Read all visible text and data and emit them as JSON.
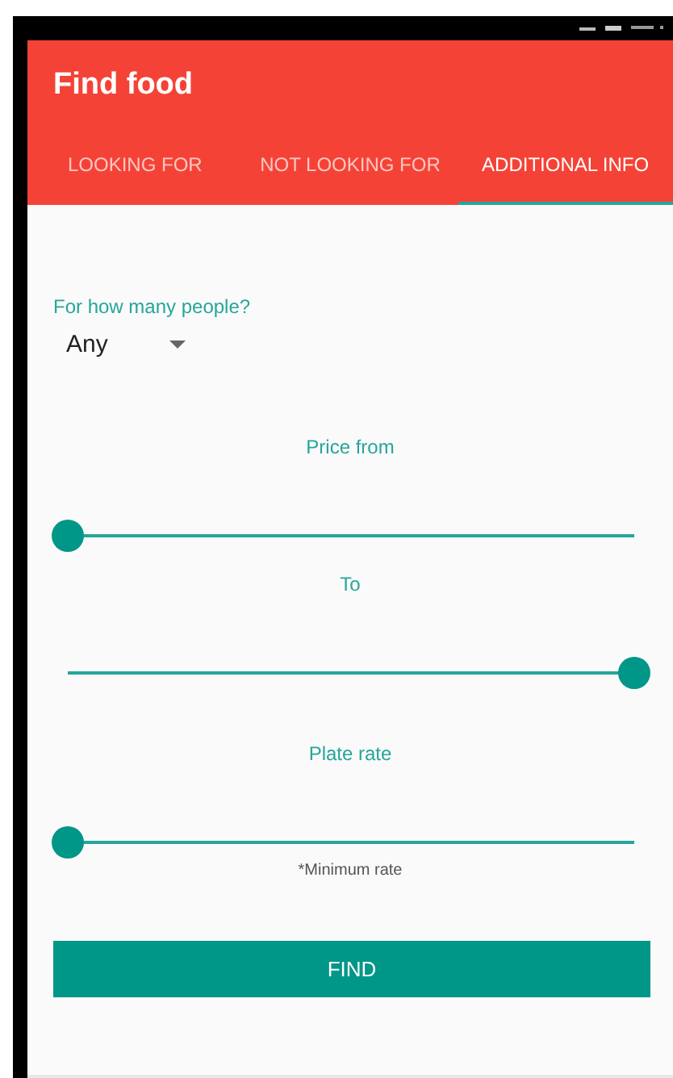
{
  "app_bar": {
    "title": "Find food"
  },
  "tabs": [
    {
      "label": "LOOKING FOR",
      "selected": false
    },
    {
      "label": "NOT LOOKING FOR",
      "selected": false
    },
    {
      "label": "ADDITIONAL INFO",
      "selected": true
    }
  ],
  "people": {
    "label": "For how many people?",
    "value": "Any"
  },
  "sliders": [
    {
      "label": "Price from",
      "level": 0
    },
    {
      "label": "To",
      "level": 1
    },
    {
      "label": "Plate rate",
      "level": 0,
      "note": "*Minimum rate"
    }
  ],
  "button": "FIND"
}
